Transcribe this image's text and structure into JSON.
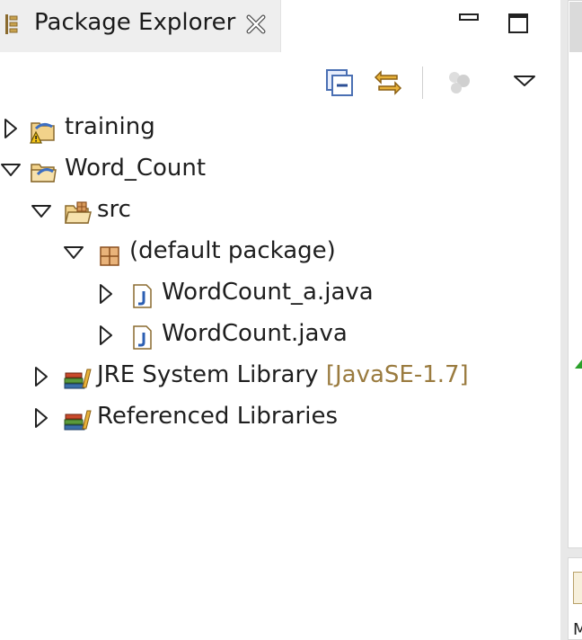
{
  "view": {
    "title": "Package Explorer",
    "close_icon": "close-icon",
    "minimize_icon": "minimize-icon",
    "maximize_icon": "maximize-icon"
  },
  "toolbar": {
    "icons": [
      "collapse-all-icon",
      "link-with-editor-icon",
      "filters-icon",
      "view-menu-icon"
    ]
  },
  "tree": [
    {
      "label": "training",
      "icon": "project-warning-icon",
      "state": "collapsed"
    },
    {
      "label": "Word_Count",
      "icon": "project-icon",
      "state": "expanded"
    },
    {
      "label": "src",
      "icon": "source-folder-icon",
      "state": "expanded"
    },
    {
      "label": "(default package)",
      "icon": "package-icon",
      "state": "expanded"
    },
    {
      "label": "WordCount_a.java",
      "icon": "java-file-icon",
      "state": "collapsed"
    },
    {
      "label": "WordCount.java",
      "icon": "java-file-icon",
      "state": "collapsed"
    },
    {
      "label": "JRE System Library",
      "decoration": "[JavaSE-1.7]",
      "icon": "library-icon",
      "state": "collapsed"
    },
    {
      "label": "Referenced Libraries",
      "icon": "library-icon",
      "state": "collapsed"
    }
  ],
  "side_panel": {
    "text": "M"
  },
  "colors": {
    "decoration": "#9a7b3f",
    "tab_bg": "#eeeeee"
  }
}
